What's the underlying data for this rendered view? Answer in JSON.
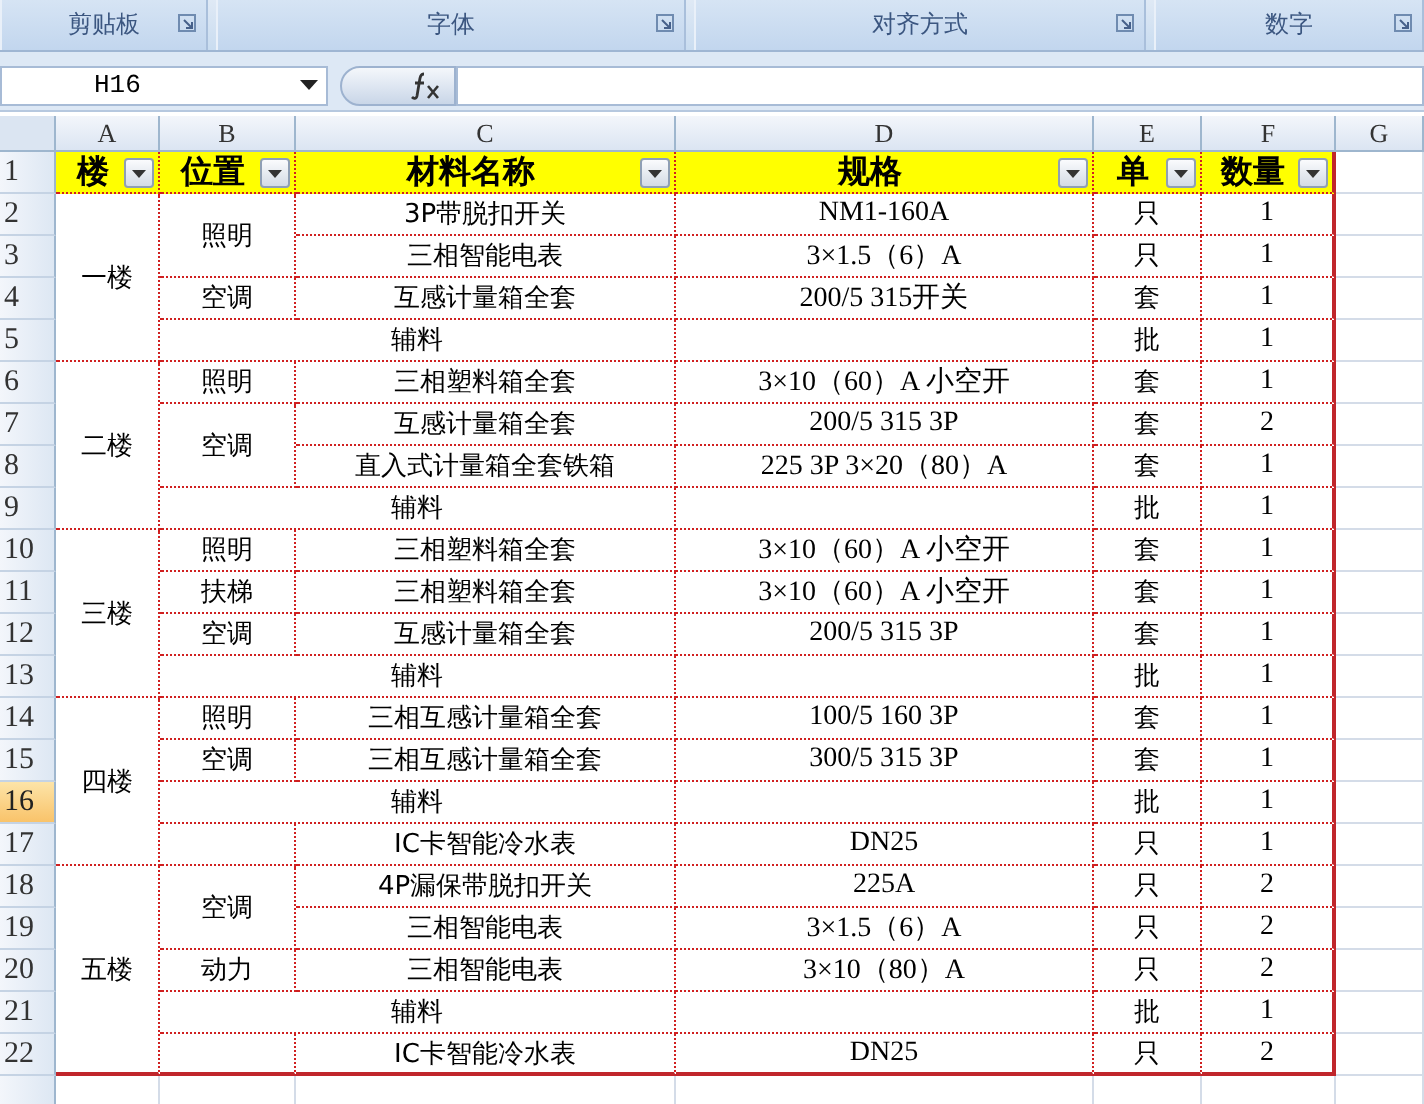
{
  "ribbon": {
    "groups": [
      {
        "label": "剪贴板"
      },
      {
        "label": "字体"
      },
      {
        "label": "对齐方式"
      },
      {
        "label": "数字"
      }
    ]
  },
  "formula_bar": {
    "name_box": "H16"
  },
  "sheet": {
    "column_headers": [
      "A",
      "B",
      "C",
      "D",
      "E",
      "F",
      "G"
    ],
    "header_row": {
      "row": "1",
      "selected": false,
      "cells": [
        {
          "text": "楼",
          "filter": true
        },
        {
          "text": "位置",
          "filter": true
        },
        {
          "text": "材料名称",
          "filter": true
        },
        {
          "text": "规格",
          "filter": true
        },
        {
          "text": "单",
          "filter": true
        },
        {
          "text": "数量",
          "filter": true
        }
      ]
    },
    "floors": [
      {
        "label": "一楼",
        "entries": [
          {
            "kind": "location",
            "label": "照明",
            "items": [
              {
                "row": "2",
                "selected": false,
                "name": "3P带脱扣开关",
                "spec": "NM1-160A",
                "unit": "只",
                "qty": "1"
              },
              {
                "row": "3",
                "selected": false,
                "name": "三相智能电表",
                "spec": "3×1.5（6）A",
                "unit": "只",
                "qty": "1"
              }
            ]
          },
          {
            "kind": "location",
            "label": "空调",
            "items": [
              {
                "row": "4",
                "selected": false,
                "name": "互感计量箱全套",
                "spec": "200/5 315开关",
                "unit": "套",
                "qty": "1"
              }
            ]
          },
          {
            "kind": "misc",
            "row": "5",
            "selected": false,
            "name": "辅料",
            "unit": "批",
            "qty": "1"
          }
        ]
      },
      {
        "label": "二楼",
        "entries": [
          {
            "kind": "location",
            "label": "照明",
            "items": [
              {
                "row": "6",
                "selected": false,
                "name": "三相塑料箱全套",
                "spec": "3×10（60）A 小空开",
                "unit": "套",
                "qty": "1"
              }
            ]
          },
          {
            "kind": "location",
            "label": "空调",
            "items": [
              {
                "row": "7",
                "selected": false,
                "name": "互感计量箱全套",
                "spec": "200/5 315 3P",
                "unit": "套",
                "qty": "2"
              },
              {
                "row": "8",
                "selected": false,
                "name": "直入式计量箱全套铁箱",
                "spec": "225 3P 3×20（80）A",
                "unit": "套",
                "qty": "1"
              }
            ]
          },
          {
            "kind": "misc",
            "row": "9",
            "selected": false,
            "name": "辅料",
            "unit": "批",
            "qty": "1"
          }
        ]
      },
      {
        "label": "三楼",
        "entries": [
          {
            "kind": "location",
            "label": "照明",
            "items": [
              {
                "row": "10",
                "selected": false,
                "name": "三相塑料箱全套",
                "spec": "3×10（60）A 小空开",
                "unit": "套",
                "qty": "1"
              }
            ]
          },
          {
            "kind": "location",
            "label": "扶梯",
            "items": [
              {
                "row": "11",
                "selected": false,
                "name": "三相塑料箱全套",
                "spec": "3×10（60）A 小空开",
                "unit": "套",
                "qty": "1"
              }
            ]
          },
          {
            "kind": "location",
            "label": "空调",
            "items": [
              {
                "row": "12",
                "selected": false,
                "name": "互感计量箱全套",
                "spec": "200/5 315 3P",
                "unit": "套",
                "qty": "1"
              }
            ]
          },
          {
            "kind": "misc",
            "row": "13",
            "selected": false,
            "name": "辅料",
            "unit": "批",
            "qty": "1"
          }
        ]
      },
      {
        "label": "四楼",
        "entries": [
          {
            "kind": "location",
            "label": "照明",
            "items": [
              {
                "row": "14",
                "selected": false,
                "name": "三相互感计量箱全套",
                "spec": "100/5 160 3P",
                "unit": "套",
                "qty": "1"
              }
            ]
          },
          {
            "kind": "location",
            "label": "空调",
            "items": [
              {
                "row": "15",
                "selected": false,
                "name": "三相互感计量箱全套",
                "spec": "300/5 315 3P",
                "unit": "套",
                "qty": "1"
              }
            ]
          },
          {
            "kind": "misc",
            "row": "16",
            "selected": true,
            "name": "辅料",
            "unit": "批",
            "qty": "1"
          },
          {
            "kind": "location",
            "items": [
              {
                "row": "17",
                "selected": false,
                "name": "IC卡智能冷水表",
                "spec": "DN25",
                "unit": "只",
                "qty": "1"
              }
            ]
          }
        ]
      },
      {
        "label": "五楼",
        "entries": [
          {
            "kind": "location",
            "label": "空调",
            "items": [
              {
                "row": "18",
                "selected": false,
                "name": "4P漏保带脱扣开关",
                "spec": "225A",
                "unit": "只",
                "qty": "2"
              },
              {
                "row": "19",
                "selected": false,
                "name": "三相智能电表",
                "spec": "3×1.5（6）A",
                "unit": "只",
                "qty": "2"
              }
            ]
          },
          {
            "kind": "location",
            "label": "动力",
            "items": [
              {
                "row": "20",
                "selected": false,
                "name": "三相智能电表",
                "spec": "3×10（80）A",
                "unit": "只",
                "qty": "2"
              }
            ]
          },
          {
            "kind": "misc",
            "row": "21",
            "selected": false,
            "name": "辅料",
            "unit": "批",
            "qty": "1"
          },
          {
            "kind": "location",
            "items": [
              {
                "row": "22",
                "selected": false,
                "name": "IC卡智能冷水表",
                "spec": "DN25",
                "unit": "只",
                "qty": "2"
              }
            ]
          }
        ]
      }
    ]
  }
}
